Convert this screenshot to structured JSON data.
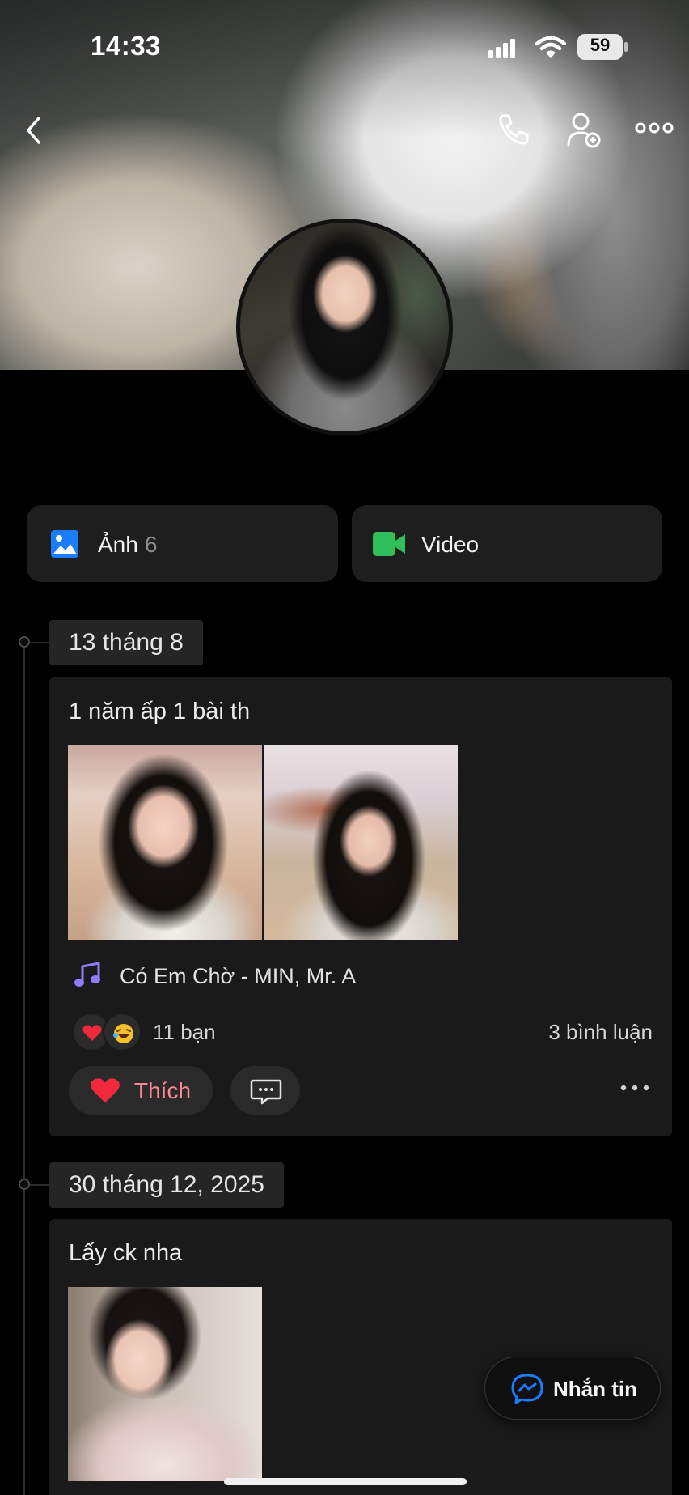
{
  "status_bar": {
    "time": "14:33",
    "battery": "59"
  },
  "header": {
    "back_icon": "chevron-left-icon",
    "actions": [
      "phone-icon",
      "add-friend-icon",
      "more-icon"
    ]
  },
  "media_tabs": [
    {
      "label": "Ảnh",
      "count": "6",
      "icon": "photo-icon",
      "accent": "#1a7cff"
    },
    {
      "label": "Video",
      "icon": "video-icon",
      "accent": "#2fc05a"
    }
  ],
  "timeline": [
    {
      "date": "13 tháng 8",
      "text": "1 năm ấp 1 bài th",
      "music": "Có Em Chờ - MIN, Mr. A",
      "reactions_label": "11 bạn",
      "reaction_icons": [
        "heart-icon",
        "laughing-icon"
      ],
      "comments_label": "3 bình luận",
      "like_label": "Thích"
    },
    {
      "date": "30 tháng 12, 2025",
      "text": "Lấy ck nha"
    }
  ],
  "message_button": {
    "label": "Nhắn tin",
    "icon": "messenger-icon"
  },
  "colors": {
    "background": "#000000",
    "card": "#1a1a1a",
    "like": "#ff8a95",
    "messenger": "#1a7cff"
  }
}
